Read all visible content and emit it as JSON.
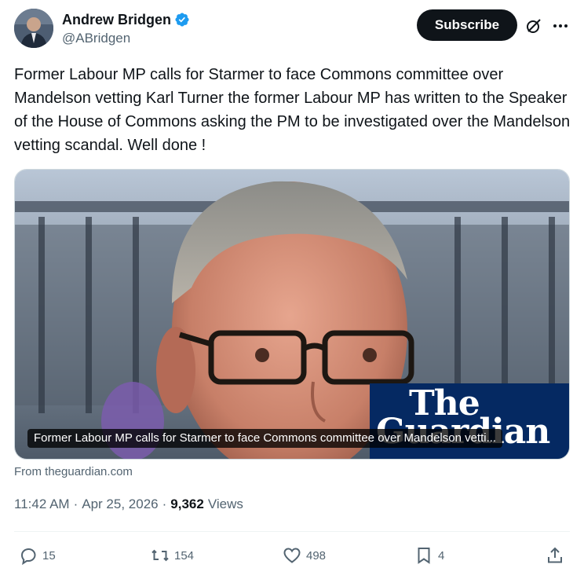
{
  "author": {
    "display_name": "Andrew Bridgen",
    "handle": "@ABridgen",
    "verified_icon": "verified-badge-icon",
    "accent_color": "#1d9bf0"
  },
  "header": {
    "subscribe_label": "Subscribe",
    "grok_icon": "grok-icon",
    "more_icon": "more-options-icon"
  },
  "tweet": {
    "text": "Former Labour MP calls for Starmer to face Commons committee over Mandelson vetting Karl Turner the former Labour MP has written to the Speaker of the House of Commons asking the PM to be investigated over the Mandelson vetting scandal. Well done !"
  },
  "card": {
    "caption": "Former Labour MP calls for Starmer to face Commons committee over Mandelson vetti...",
    "logo_line1": "The",
    "logo_line2": "Guardian",
    "source": "From theguardian.com"
  },
  "meta": {
    "time": "11:42 AM",
    "date": "Apr 25, 2026",
    "views_count": "9,362",
    "views_label": "Views",
    "separator": "·"
  },
  "actions": {
    "replies": "15",
    "reposts": "154",
    "likes": "498",
    "bookmarks": "4"
  }
}
